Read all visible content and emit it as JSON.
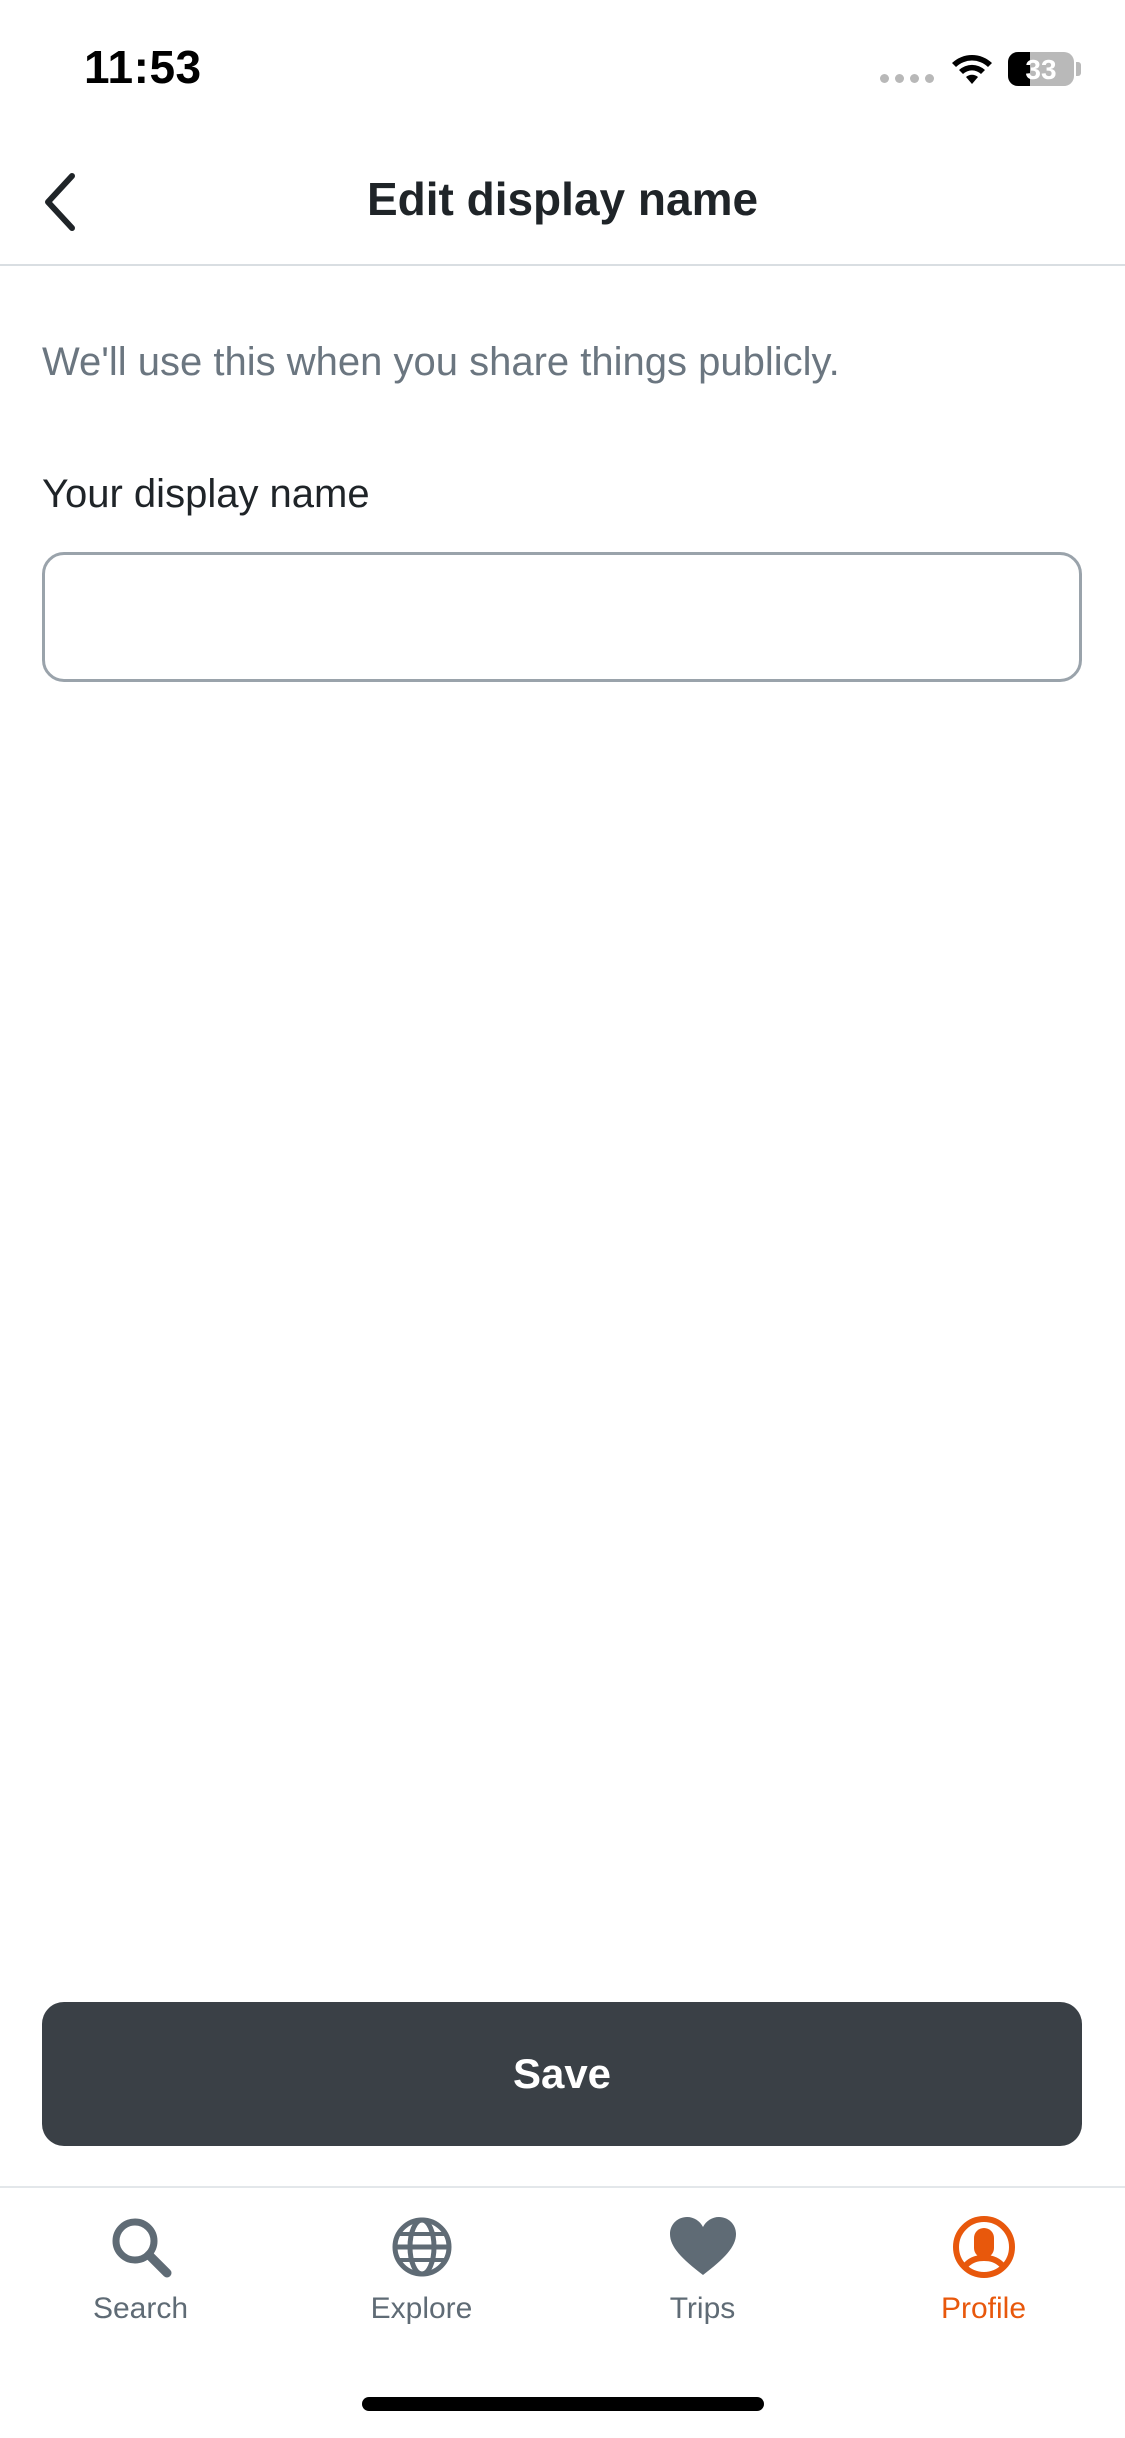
{
  "status_bar": {
    "time": "11:53",
    "battery_percent": "33",
    "battery_level": 0.33
  },
  "header": {
    "title": "Edit display name",
    "back_icon": "chevron-left-icon"
  },
  "content": {
    "intro_text": "We'll use this when you share things publicly.",
    "field_label": "Your display name",
    "field_value": "",
    "field_placeholder": ""
  },
  "actions": {
    "save_label": "Save"
  },
  "tab_bar": {
    "items": [
      {
        "label": "Search",
        "icon": "search-icon",
        "active": false
      },
      {
        "label": "Explore",
        "icon": "globe-icon",
        "active": false
      },
      {
        "label": "Trips",
        "icon": "heart-icon",
        "active": false
      },
      {
        "label": "Profile",
        "icon": "profile-icon",
        "active": true
      }
    ]
  },
  "colors": {
    "accent": "#e8580c",
    "button_bg": "#3a4046",
    "muted_text": "#6b7680",
    "icon_inactive": "#5f6b75"
  }
}
